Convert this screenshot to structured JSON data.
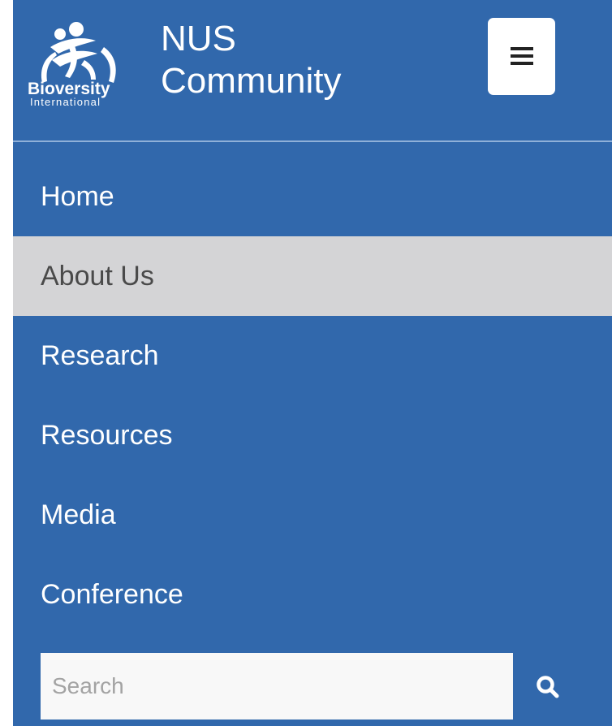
{
  "header": {
    "logo": {
      "org_name": "Bioversity",
      "org_subtitle": "International"
    },
    "title": "NUS\nCommunity",
    "menu_toggle_icon": "hamburger-icon"
  },
  "nav": {
    "items": [
      {
        "label": "Home",
        "active": false
      },
      {
        "label": "About Us",
        "active": true
      },
      {
        "label": "Research",
        "active": false
      },
      {
        "label": "Resources",
        "active": false
      },
      {
        "label": "Media",
        "active": false
      },
      {
        "label": "Conference",
        "active": false
      }
    ]
  },
  "search": {
    "placeholder": "Search",
    "value": "",
    "button_icon": "search-icon"
  },
  "colors": {
    "brand_blue": "#3168ac",
    "active_item_bg": "#d4d4d6",
    "text_light": "#ffffff",
    "text_dark": "#4a4a4a"
  }
}
